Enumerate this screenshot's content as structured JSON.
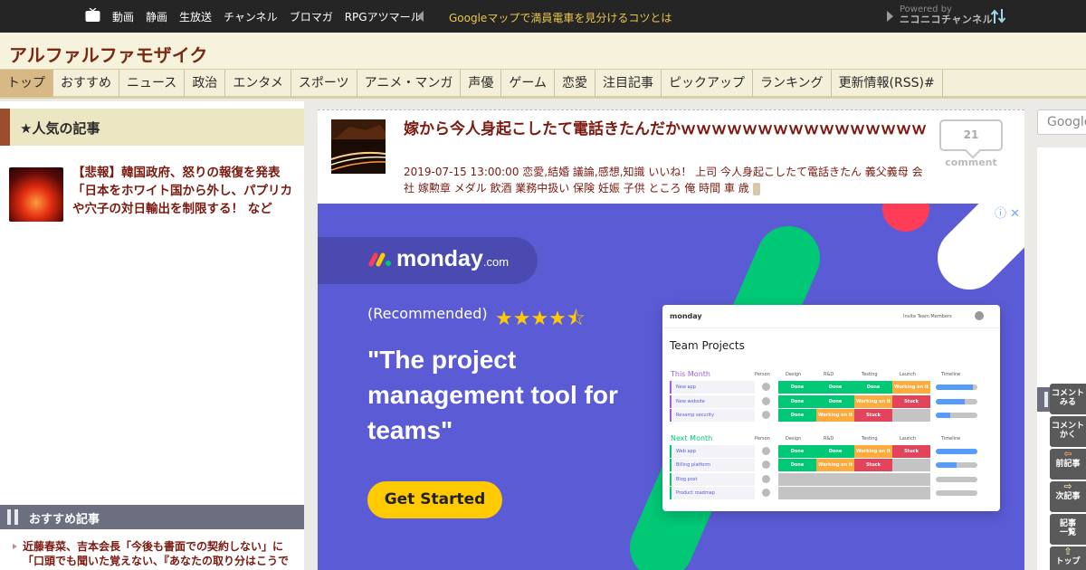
{
  "topbar": {
    "nav": [
      "動画",
      "静画",
      "生放送",
      "チャンネル",
      "ブロマガ",
      "RPGアツマール"
    ],
    "headline": "Googleマップで満員電車を見分けるコツとは",
    "powered_by": "Powered by",
    "channel": "ニコニコチャンネル"
  },
  "site": {
    "title": "アルファルファモザイク"
  },
  "tabs": [
    "トップ",
    "おすすめ",
    "ニュース",
    "政治",
    "エンタメ",
    "スポーツ",
    "アニメ・マンガ",
    "声優",
    "ゲーム",
    "恋愛",
    "注目記事",
    "ピックアップ",
    "ランキング",
    "更新情報(RSS)#"
  ],
  "sidebar": {
    "popular_heading": "★人気の記事",
    "popular_article": "【悲報】韓国政府、怒りの報復を発表「日本をホワイト国から外し、パプリカや穴子の対日輸出を制限する！ など",
    "recommended_heading": "おすすめ記事",
    "recommended_article": "近藤春菜、吉本会長「今後も書面での契約しない」に「口頭でも聞いた覚えない、『あなたの取り分はこうで"
  },
  "article": {
    "title": "嫁から今人身起こしたて電話きたんだかｗｗｗｗｗｗｗｗｗｗｗｗｗｗｗｗ",
    "meta": "2019-07-15 13:00:00 恋愛,結婚 議論,感想,知識 いいね！ 上司 今人身起こしたて電話きたん 義父義母 会社 嫁勲章 メダル 飲酒 業務中扱い 保険 妊娠 子供 ところ 俺 時間 車 歳",
    "comment_count": "21",
    "comment_label": "comment"
  },
  "ad": {
    "brand": "monday",
    "brand_suffix": ".com",
    "recommended": "(Recommended)",
    "stars": "★★★★⯪",
    "rating": 4.5,
    "quote": "\"The project management tool for teams\"",
    "cta": "Get Started",
    "adchoice": "ⓘ ✕",
    "mock": {
      "logo": "monday",
      "invite": "Invite Team Members",
      "title": "Team Projects",
      "columns": [
        "Person",
        "Design",
        "R&D",
        "Testing",
        "Launch",
        "Timeline"
      ],
      "groups": [
        {
          "name": "This Month",
          "color": "#a25ddc",
          "rows": [
            {
              "label": "New app",
              "cells": [
                "Done",
                "Done",
                "Done",
                "Working on it"
              ],
              "progress": 0.9
            },
            {
              "label": "New website",
              "cells": [
                "Done",
                "Done",
                "Working on it",
                "Stuck"
              ],
              "progress": 0.7
            },
            {
              "label": "Revamp security",
              "cells": [
                "Done",
                "Working on it",
                "Stuck",
                ""
              ],
              "progress": 0.35
            }
          ]
        },
        {
          "name": "Next Month",
          "color": "#00c875",
          "rows": [
            {
              "label": "Web app",
              "cells": [
                "Done",
                "Done",
                "Working on it",
                "Stuck"
              ],
              "progress": 1.0
            },
            {
              "label": "Billing platform",
              "cells": [
                "Done",
                "Working on it",
                "Stuck",
                ""
              ],
              "progress": 0.5
            },
            {
              "label": "Blog post",
              "cells": [
                "",
                "",
                "",
                ""
              ],
              "progress": 0
            },
            {
              "label": "Product roadmap",
              "cells": [
                "",
                "",
                "",
                ""
              ],
              "progress": 0
            }
          ]
        }
      ]
    }
  },
  "right": {
    "search_placeholder": "Google"
  },
  "tools": [
    {
      "label": "コメント\nみる",
      "sym": ""
    },
    {
      "label": "コメント\nかく",
      "sym": ""
    },
    {
      "label": "前記事",
      "sym": "⇦"
    },
    {
      "label": "次記事",
      "sym": "⇨"
    },
    {
      "label": "記事\n一覧",
      "sym": ""
    },
    {
      "label": "トップ",
      "sym": "⇧"
    }
  ],
  "colors": {
    "done": "#00c875",
    "working": "#fdab3d",
    "stuck": "#e2445c",
    "empty": "#c4c4c4",
    "ad_bg": "#5b5bd6",
    "accent_title": "#7a1a10"
  }
}
